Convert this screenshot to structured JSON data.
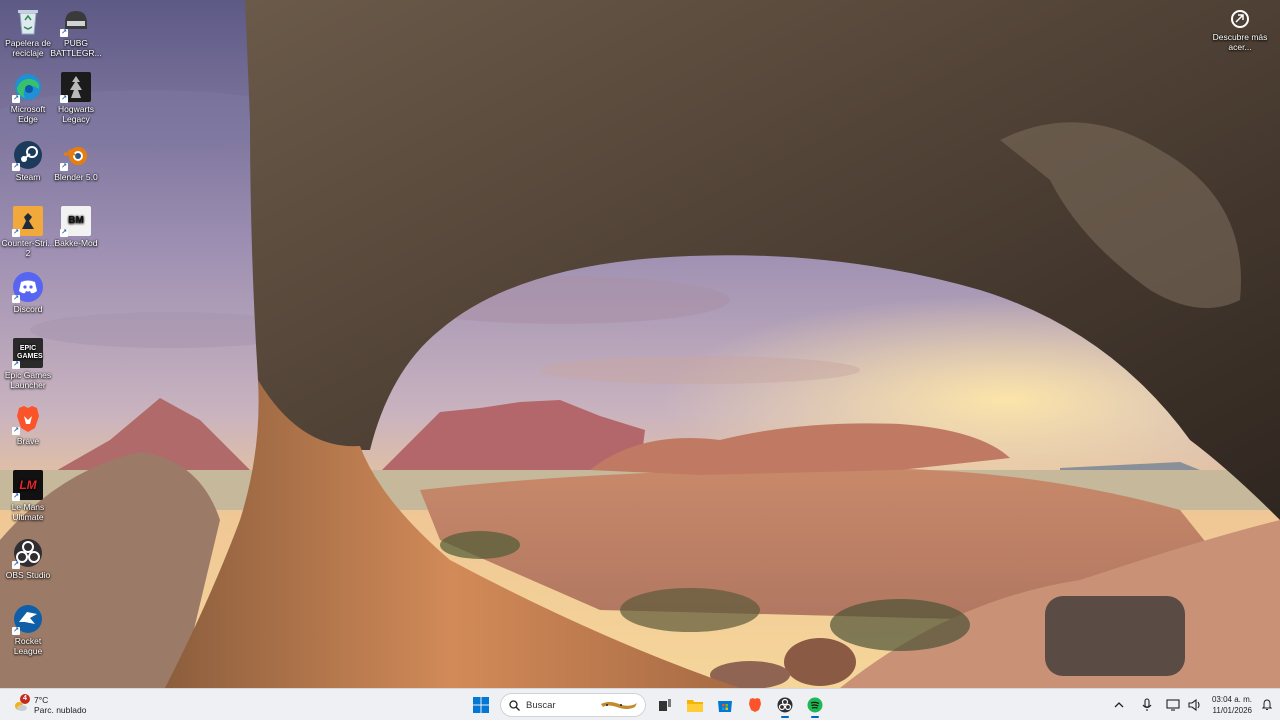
{
  "desktop": {
    "icons": [
      {
        "id": "recycle",
        "label": "Papelera de reciclaje",
        "icon": "recycle-bin-icon"
      },
      {
        "id": "pubg",
        "label": "PUBG BATTLEGR...",
        "icon": "pubg-icon"
      },
      {
        "id": "edge",
        "label": "Microsoft Edge",
        "icon": "edge-icon"
      },
      {
        "id": "hogwarts",
        "label": "Hogwarts Legacy",
        "icon": "hogwarts-icon"
      },
      {
        "id": "steam",
        "label": "Steam",
        "icon": "steam-icon"
      },
      {
        "id": "blender",
        "label": "Blender 5.0",
        "icon": "blender-icon"
      },
      {
        "id": "cs",
        "label": "Counter-Stri... 2",
        "icon": "counter-strike-icon"
      },
      {
        "id": "bakkes",
        "label": "Bakke-Mod",
        "icon": "bakkesmod-icon"
      },
      {
        "id": "discord",
        "label": "Discord",
        "icon": "discord-icon"
      },
      {
        "id": "epic",
        "label": "Epic Games Launcher",
        "icon": "epic-games-icon"
      },
      {
        "id": "brave",
        "label": "Brave",
        "icon": "brave-icon"
      },
      {
        "id": "lmu",
        "label": "Le Mans Ultimate",
        "icon": "le-mans-icon"
      },
      {
        "id": "obs",
        "label": "OBS Studio",
        "icon": "obs-icon"
      },
      {
        "id": "rocket",
        "label": "Rocket League",
        "icon": "rocket-league-icon"
      }
    ],
    "epic_logo_text": "EPIC GAMES",
    "lmu_logo_text": "LM",
    "bakkes_logo_text": "BM"
  },
  "discover": {
    "label": "Descubre más acer..."
  },
  "taskbar": {
    "weather": {
      "temp": "7°C",
      "condition": "Parc. nublado",
      "badge": "4"
    },
    "search": {
      "placeholder": "Buscar"
    },
    "apps": [
      "start-button",
      "search",
      "task-view",
      "file-explorer",
      "microsoft-store",
      "brave",
      "obs",
      "spotify"
    ],
    "clock": {
      "time": "03:04 a. m.",
      "date": "11/01/2026"
    }
  },
  "colors": {
    "accent": "#0067c0",
    "taskbar": "#eef0f3"
  }
}
